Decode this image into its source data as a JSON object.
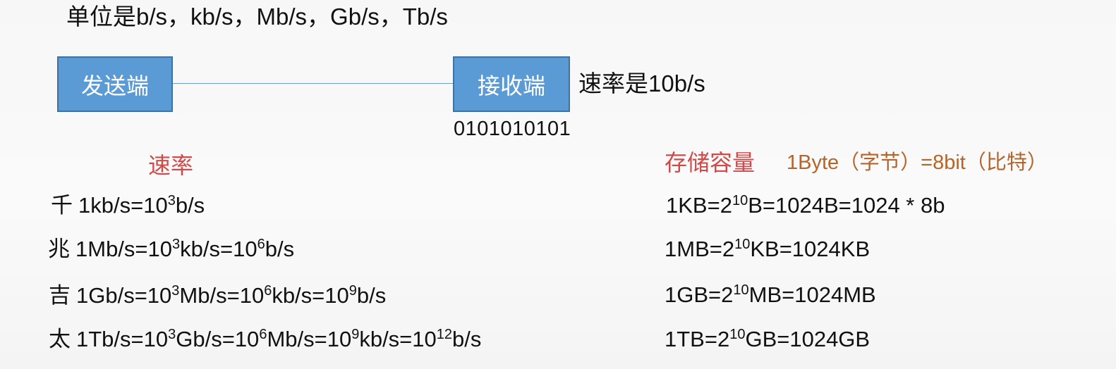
{
  "header": {
    "units_text": "单位是b/s，kb/s，Mb/s，Gb/s，Tb/s"
  },
  "diagram": {
    "sender_label": "发送端",
    "receiver_label": "接收端",
    "rate_text": "速率是10b/s",
    "bit_stream": "0101010101"
  },
  "rate_section": {
    "heading": "速率",
    "rows": [
      {
        "prefix": "千",
        "parts": [
          "1kb/s=10",
          "3",
          "b/s"
        ]
      },
      {
        "prefix": "兆",
        "parts": [
          "1Mb/s=10",
          "3",
          "kb/s=10",
          "6",
          "b/s"
        ]
      },
      {
        "prefix": "吉",
        "parts": [
          "1Gb/s=10",
          "3",
          "Mb/s=10",
          "6",
          "kb/s=10",
          "9",
          "b/s"
        ]
      },
      {
        "prefix": "太",
        "parts": [
          "1Tb/s=10",
          "3",
          "Gb/s=10",
          "6",
          "Mb/s=10",
          "9",
          "kb/s=10",
          "12",
          "b/s"
        ]
      }
    ]
  },
  "storage_section": {
    "heading": "存储容量",
    "byte_def": "1Byte（字节）=8bit（比特）",
    "rows": [
      {
        "parts": [
          "1KB=2",
          "10",
          "B=1024B=1024 * 8b"
        ]
      },
      {
        "parts": [
          "1MB=2",
          "10",
          "KB=1024KB"
        ]
      },
      {
        "parts": [
          "1GB=2",
          "10",
          "MB=1024MB"
        ]
      },
      {
        "parts": [
          "1TB=2",
          "10",
          "GB=1024GB"
        ]
      }
    ]
  },
  "colors": {
    "box_fill": "#5b9bd5",
    "box_border": "#41719c",
    "heading_red": "#d04a4a",
    "byte_def_brown": "#b5652a"
  }
}
